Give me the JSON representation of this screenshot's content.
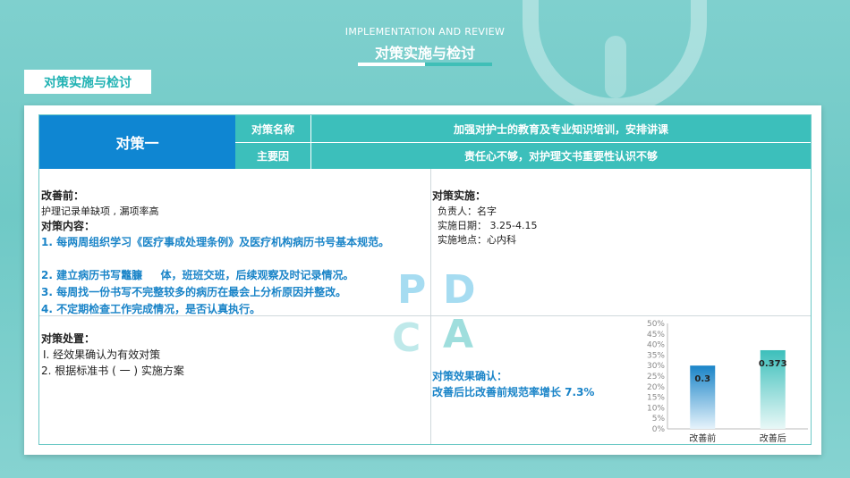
{
  "header": {
    "subtitle": "IMPLEMENTATION AND REVIEW",
    "title": "对策实施与检讨"
  },
  "section_tag": "对策实施与检讨",
  "table": {
    "measure_label": "对策一",
    "rows": [
      {
        "label": "对策名称",
        "value": "加强对护士的教育及专业知识培训，安排讲课"
      },
      {
        "label": "主要因",
        "value": "责任心不够，对护理文书重要性认识不够"
      }
    ]
  },
  "before": {
    "heading": "改善前：",
    "text": "护理记录单缺项 , 漏项率高"
  },
  "content": {
    "heading": "对策内容：",
    "items": [
      "1. 每两周组织学习《医疗事成处理条例》及医疗机构病历书号基本规范。",
      "2. 建立病历书写鼈臁 　 体，班班交班，后续观察及时记录情况。",
      "3. 每周找一份书写不完整较多的病历在最会上分析原因并整改。",
      "4. 不定期检查工作完成情况，是否认真执行。"
    ]
  },
  "implementation": {
    "heading": "对策实施：",
    "lines": [
      "负责人：名字",
      "实施日期： 3.25-4.15",
      "实施地点：心内科"
    ]
  },
  "disposal": {
    "heading": "对策处置：",
    "items": [
      "I. 经效果确认为有效对策",
      "2. 根据标准书 ( 一 ) 实施方案"
    ]
  },
  "effect": {
    "heading": "对策效果确认：",
    "text": "改善后比改善前规范率增长 7.3%"
  },
  "pdca": [
    "P",
    "D",
    "C",
    "A"
  ],
  "colors": {
    "measure_blue": "#0f86d2",
    "teal": "#3cbfbb",
    "text_blue": "#1a84c8"
  },
  "chart_data": {
    "type": "bar",
    "categories": [
      "改善前",
      "改善后"
    ],
    "values": [
      0.3,
      0.373
    ],
    "value_labels": [
      "0.3",
      "0.373"
    ],
    "ylim": [
      0,
      0.5
    ],
    "yticks": [
      "0%",
      "5%",
      "10%",
      "15%",
      "20%",
      "25%",
      "30%",
      "35%",
      "40%",
      "45%",
      "50%"
    ],
    "bar_colors": [
      "#1a84c8",
      "#3cbfbb"
    ]
  }
}
